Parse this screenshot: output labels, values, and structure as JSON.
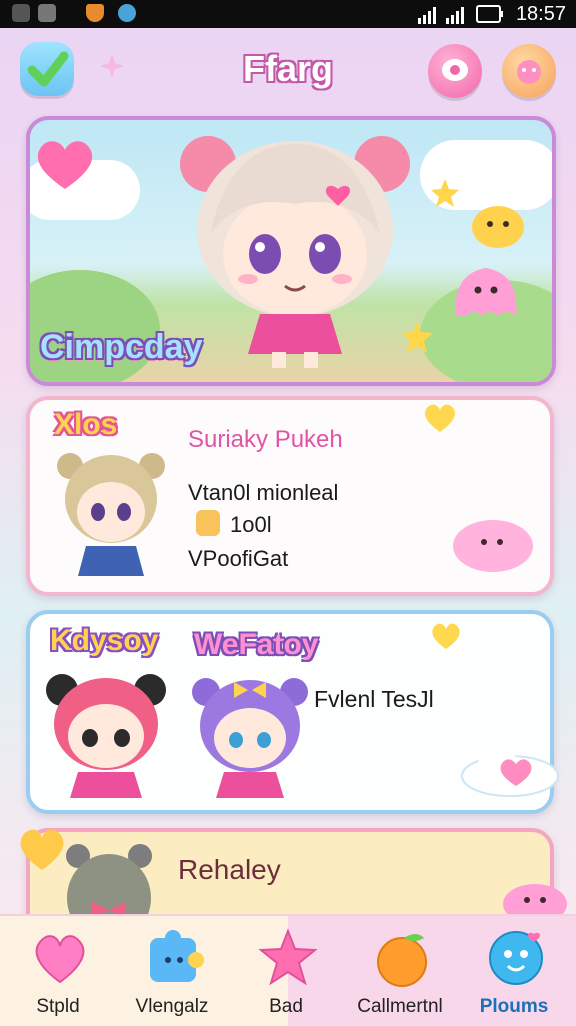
{
  "status_bar": {
    "time": "18:57"
  },
  "header": {
    "title": "Ffarg"
  },
  "hero": {
    "label": "Cimpcday"
  },
  "card_profile": {
    "badge": "Xlos",
    "name": "Suriaky Pukeh",
    "stat1": "Vtan0l mionleal",
    "stat2": "1o0l",
    "stat3": "VPoofiGat"
  },
  "card_duo": {
    "label_left": "Kdysoy",
    "label_right": "WeFatoy",
    "text": "Fvlenl TesJl"
  },
  "card_next": {
    "title": "Rehaley"
  },
  "nav": [
    {
      "label": "Stpld",
      "icon": "heart-icon",
      "color": "#ff7ec4"
    },
    {
      "label": "Vlengalz",
      "icon": "puzzle-icon",
      "color": "#59b8f5"
    },
    {
      "label": "Bad",
      "icon": "star-icon",
      "color": "#ff6fb0"
    },
    {
      "label": "Callmertnl",
      "icon": "orange-fruit-icon",
      "color": "#ff9d2e"
    },
    {
      "label": "Ploums",
      "icon": "blob-character-icon",
      "color": "#3fb8f0"
    }
  ]
}
